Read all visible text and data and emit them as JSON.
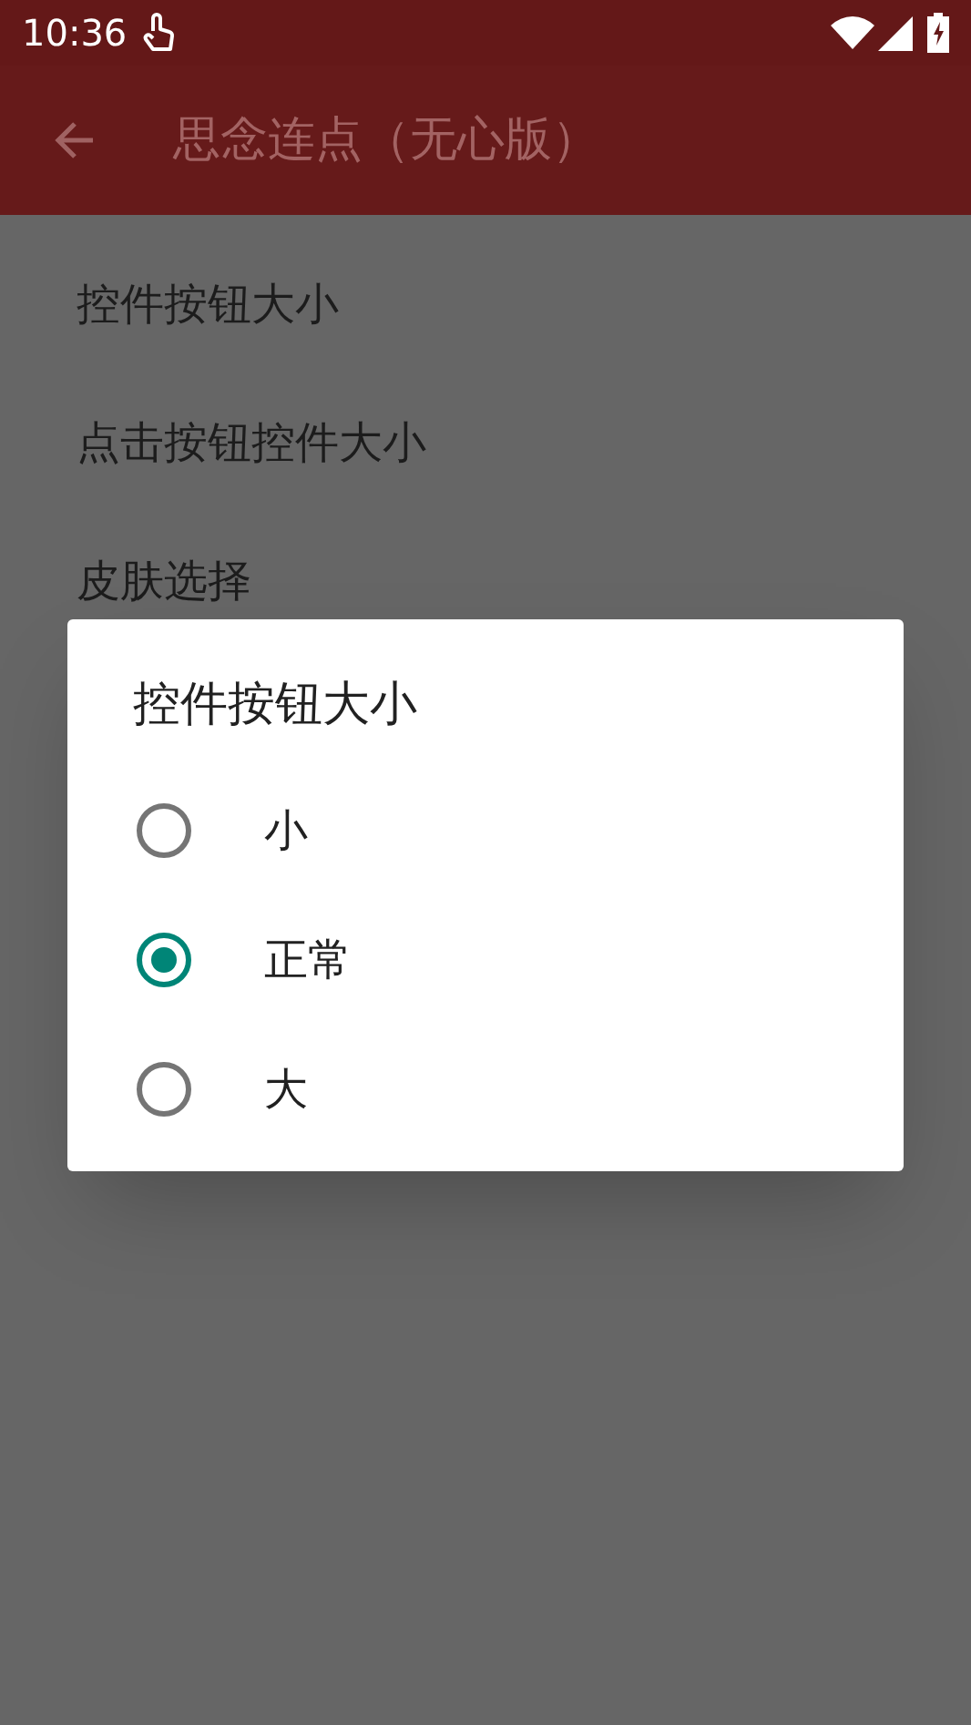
{
  "status_bar": {
    "time": "10:36"
  },
  "app_bar": {
    "title": "思念连点（无心版）"
  },
  "settings": [
    {
      "label": "控件按钮大小"
    },
    {
      "label": "点击按钮控件大小"
    },
    {
      "label": "皮肤选择"
    }
  ],
  "dialog": {
    "title": "控件按钮大小",
    "options": [
      {
        "label": "小",
        "selected": false
      },
      {
        "label": "正常",
        "selected": true
      },
      {
        "label": "大",
        "selected": false
      }
    ]
  }
}
